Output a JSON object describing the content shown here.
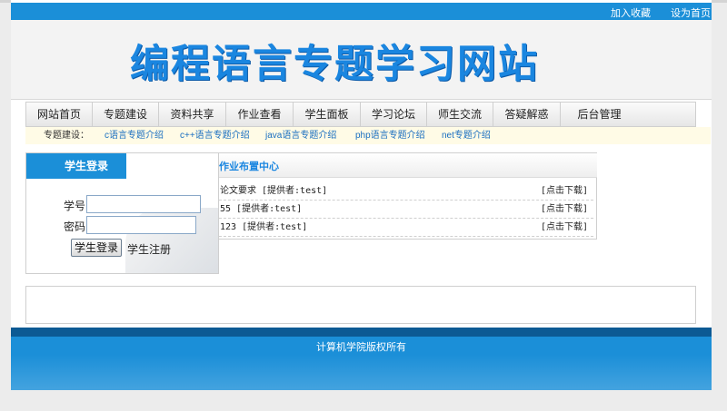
{
  "top_links": [
    "加入收藏",
    "设为首页"
  ],
  "banner_title": "编程语言专题学习网站",
  "nav": [
    "网站首页",
    "专题建设",
    "资料共享",
    "作业查看",
    "学生面板",
    "学习论坛",
    "师生交流",
    "答疑解惑",
    "后台管理"
  ],
  "subnav": {
    "label": "专题建设：",
    "links": [
      "c语言专题介绍",
      "c++语言专题介绍",
      "java语言专题介绍",
      "php语言专题介绍",
      "net专题介绍"
    ]
  },
  "login": {
    "title": "学生登录",
    "id_label": "学号",
    "pwd_label": "密码",
    "login_button": "学生登录",
    "register_link": "学生注册"
  },
  "work": {
    "title": "作业布置中心",
    "rows": [
      {
        "text": "论文要求 [提供者:test]",
        "download": "[点击下载]"
      },
      {
        "text": "55 [提供者:test]",
        "download": "[点击下载]"
      },
      {
        "text": "123 [提供者:test]",
        "download": "[点击下载]"
      }
    ]
  },
  "footer": {
    "text": "计算机学院版权所有"
  },
  "colors": {
    "accent": "#1b8fd8",
    "footer_dark": "#0c5a94",
    "title_blue": "#1a86e0"
  }
}
